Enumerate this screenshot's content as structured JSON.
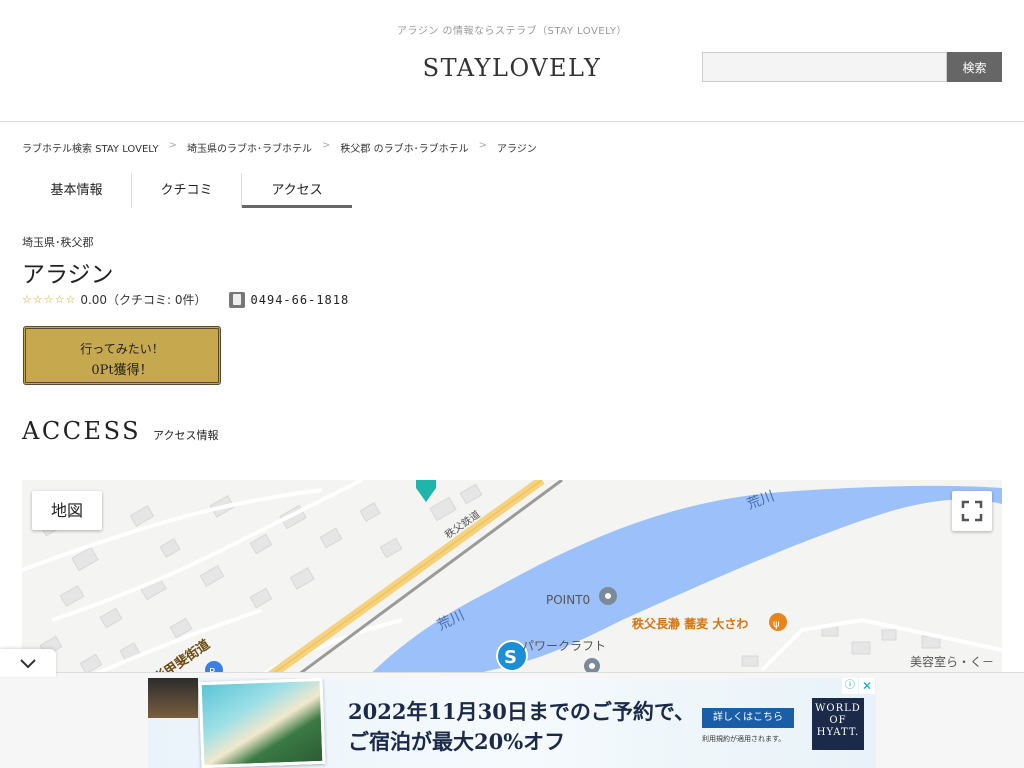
{
  "header": {
    "tagline": "アラジン の情報ならステラブ（STAY LOVELY）",
    "logo": "STAYLOVELY",
    "search": {
      "placeholder": "",
      "button_label": "検索"
    }
  },
  "breadcrumb": [
    "ラブホテル検索 STAY LOVELY",
    "埼玉県のラブホ･ラブホテル",
    "秩父郡 のラブホ･ラブホテル",
    "アラジン"
  ],
  "breadcrumb_separator": ">",
  "tabs": [
    {
      "label": "基本情報",
      "active": false
    },
    {
      "label": "クチコミ",
      "active": false
    },
    {
      "label": "アクセス",
      "active": true
    }
  ],
  "hotel": {
    "region": "埼玉県･秩父郡",
    "name": "アラジン",
    "stars": "☆☆☆☆☆",
    "score_text": "0.00（クチコミ: 0件）",
    "phone": "0494-66-1818"
  },
  "wish_button": {
    "line1": "行ってみたい！",
    "line2": "0Pt獲得！"
  },
  "access": {
    "title_en": "ACCESS",
    "title_ja": "アクセス情報"
  },
  "map": {
    "type_button": "地図",
    "labels": {
      "river_1": "荒川",
      "river_2": "荒川",
      "railway": "秩父鉄道",
      "highway": "彩甲斐街道",
      "poi_1": "POINT0",
      "poi_2": "秩父長瀞 蕎麦 大さわ",
      "poi_3": "パワークラフト",
      "poi_4": "美容室ら・く－"
    },
    "colors": {
      "water": "#9cc0f9",
      "road": "#f7d27c",
      "restaurant": "#e8851a",
      "poi": "#7a8a99"
    }
  },
  "ad": {
    "line1": "2022年11月30日までのご予約で、",
    "line2": "ご宿泊が最大20%オフ",
    "cta": "詳しくはこちら",
    "note": "利用規約が適用されます。",
    "brand_lines": [
      "WORLD",
      "OF",
      "HYATT."
    ],
    "info_icon": "ⓘ",
    "close_icon": "✕"
  }
}
